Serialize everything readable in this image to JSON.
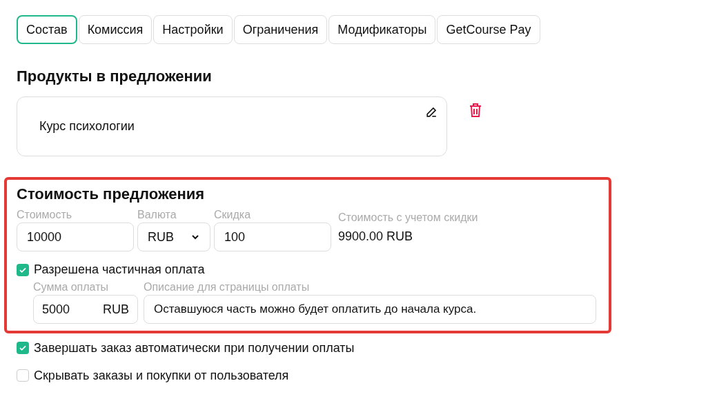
{
  "tabs": [
    {
      "label": "Состав",
      "selected": true
    },
    {
      "label": "Комиссия",
      "selected": false
    },
    {
      "label": "Настройки",
      "selected": false
    },
    {
      "label": "Ограничения",
      "selected": false
    },
    {
      "label": "Модификаторы",
      "selected": false
    },
    {
      "label": "GetCourse Pay",
      "selected": false
    }
  ],
  "products": {
    "title": "Продукты в предложении",
    "items": [
      {
        "name": "Курс психологии"
      }
    ]
  },
  "pricing": {
    "highlighted": true,
    "title": "Стоимость предложения",
    "price": {
      "label": "Стоимость",
      "value": "10000"
    },
    "currency": {
      "label": "Валюта",
      "value": "RUB"
    },
    "discount": {
      "label": "Скидка",
      "value": "100"
    },
    "discounted": {
      "label": "Стоимость с учетом скидки",
      "amount": "9900.00",
      "currency": "RUB"
    },
    "partial": {
      "label": "Разрешена частичная оплата",
      "checked": true
    },
    "partial_amount": {
      "label": "Сумма оплаты",
      "value": "5000",
      "currency": "RUB"
    },
    "partial_description": {
      "label": "Описание для страницы оплаты",
      "value": "Оставшуюся часть можно будет оплатить до начала курса."
    }
  },
  "options": [
    {
      "label": "Завершать заказ автоматически при получении оплаты",
      "checked": true
    },
    {
      "label": "Скрывать заказы и покупки от пользователя",
      "checked": false
    }
  ]
}
